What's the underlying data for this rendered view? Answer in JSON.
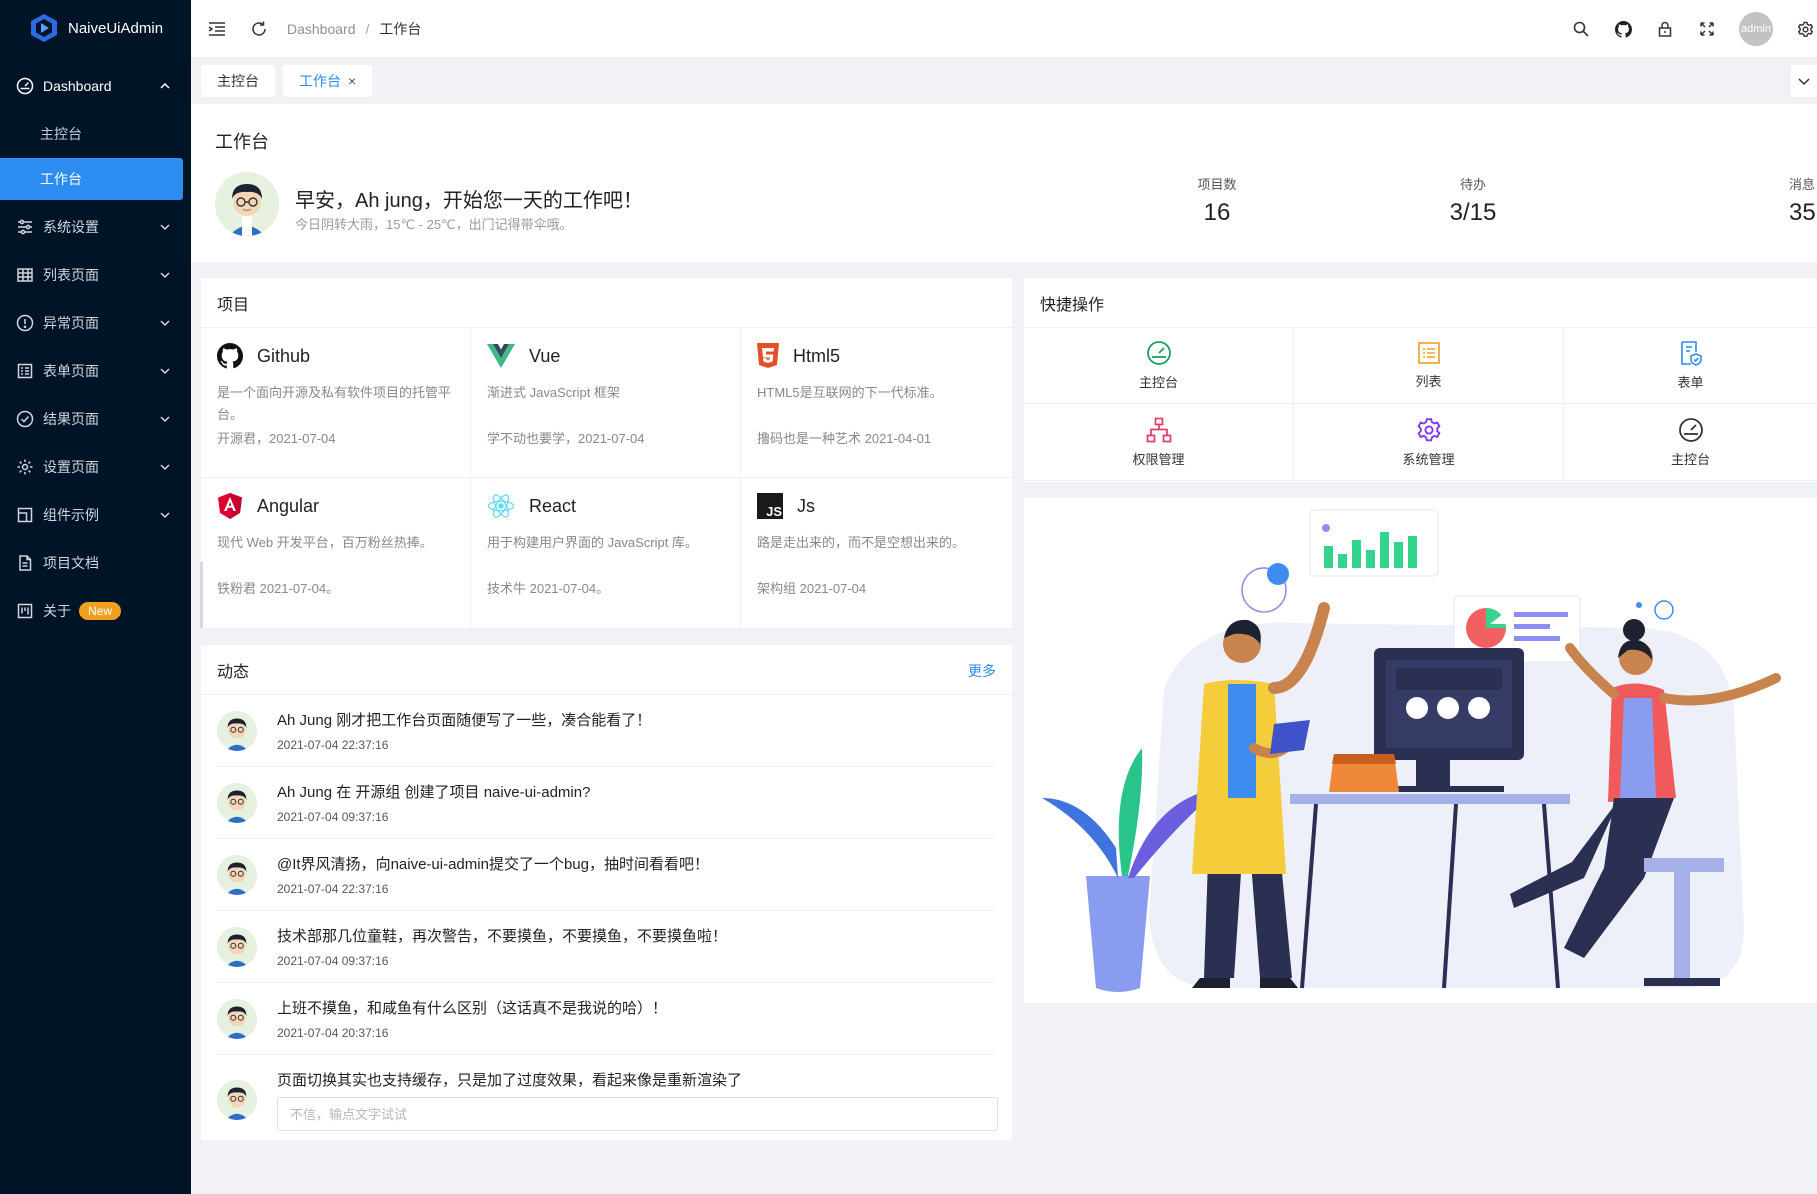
{
  "app": {
    "logo_text": "NaiveUiAdmin"
  },
  "sidebar": {
    "dashboard": {
      "label": "Dashboard",
      "children": [
        "主控台",
        "工作台"
      ]
    },
    "items": [
      {
        "label": "系统设置",
        "icon": "sliders-icon"
      },
      {
        "label": "列表页面",
        "icon": "table-icon"
      },
      {
        "label": "异常页面",
        "icon": "alert-icon"
      },
      {
        "label": "表单页面",
        "icon": "form-icon"
      },
      {
        "label": "结果页面",
        "icon": "check-circle-icon"
      },
      {
        "label": "设置页面",
        "icon": "gear-icon"
      },
      {
        "label": "组件示例",
        "icon": "component-icon"
      },
      {
        "label": "项目文档",
        "icon": "document-icon"
      },
      {
        "label": "关于",
        "icon": "about-icon",
        "badge": "New"
      }
    ]
  },
  "header": {
    "breadcrumb": {
      "root": "Dashboard",
      "sep": "/",
      "current": "工作台"
    },
    "avatar_text": "admin"
  },
  "tabs": {
    "items": [
      "主控台",
      "工作台"
    ],
    "close": "×"
  },
  "welcome": {
    "title": "工作台",
    "greeting": "早安，Ah jung，开始您一天的工作吧！",
    "weather": "今日阴转大雨，15℃ - 25℃，出门记得带伞哦。",
    "stats": [
      {
        "label": "项目数",
        "value": "16"
      },
      {
        "label": "待办",
        "value": "3/15"
      },
      {
        "label": "消息",
        "value": "35"
      }
    ]
  },
  "projects": {
    "title": "项目",
    "items": [
      {
        "name": "Github",
        "desc": "是一个面向开源及私有软件项目的托管平台。",
        "meta": "开源君，2021-07-04"
      },
      {
        "name": "Vue",
        "desc": "渐进式 JavaScript 框架",
        "meta": "学不动也要学，2021-07-04"
      },
      {
        "name": "Html5",
        "desc": "HTML5是互联网的下一代标准。",
        "meta": "撸码也是一种艺术 2021-04-01"
      },
      {
        "name": "Angular",
        "desc": "现代 Web 开发平台，百万粉丝热捧。",
        "meta": "铁粉君 2021-07-04。"
      },
      {
        "name": "React",
        "desc": "用于构建用户界面的 JavaScript 库。",
        "meta": "技术牛 2021-07-04。"
      },
      {
        "name": "Js",
        "desc": "路是走出来的，而不是空想出来的。",
        "meta": "架构组 2021-07-04"
      }
    ]
  },
  "feed": {
    "title": "动态",
    "more": "更多",
    "items": [
      {
        "text": "Ah Jung 刚才把工作台页面随便写了一些，凑合能看了！",
        "time": "2021-07-04 22:37:16"
      },
      {
        "text": "Ah Jung 在 开源组 创建了项目 naive-ui-admin?",
        "time": "2021-07-04 09:37:16"
      },
      {
        "text": "@It界风清扬，向naive-ui-admin提交了一个bug，抽时间看看吧！",
        "time": "2021-07-04 22:37:16"
      },
      {
        "text": "技术部那几位童鞋，再次警告，不要摸鱼，不要摸鱼，不要摸鱼啦！",
        "time": "2021-07-04 09:37:16"
      },
      {
        "text": "上班不摸鱼，和咸鱼有什么区别（这话真不是我说的哈）！",
        "time": "2021-07-04 20:37:16"
      },
      {
        "text": "页面切换其实也支持缓存，只是加了过度效果，看起来像是重新渲染了"
      }
    ],
    "input_placeholder": "不信，输点文字试试"
  },
  "quick": {
    "title": "快捷操作",
    "items": [
      {
        "label": "主控台",
        "icon": "dashboard-gauge-icon",
        "color": "#18a058"
      },
      {
        "label": "列表",
        "icon": "list-icon",
        "color": "#f0a020"
      },
      {
        "label": "表单",
        "icon": "form-shield-icon",
        "color": "#2d8cf0"
      },
      {
        "label": "权限管理",
        "icon": "org-chart-icon",
        "color": "#e63960"
      },
      {
        "label": "系统管理",
        "icon": "gear-icon",
        "color": "#7c3aed"
      },
      {
        "label": "主控台",
        "icon": "dashboard-gauge-icon",
        "color": "#333333"
      }
    ]
  },
  "colors": {
    "sidebar_bg": "#001428",
    "primary": "#2d8cf0",
    "badge": "#f0a020"
  }
}
